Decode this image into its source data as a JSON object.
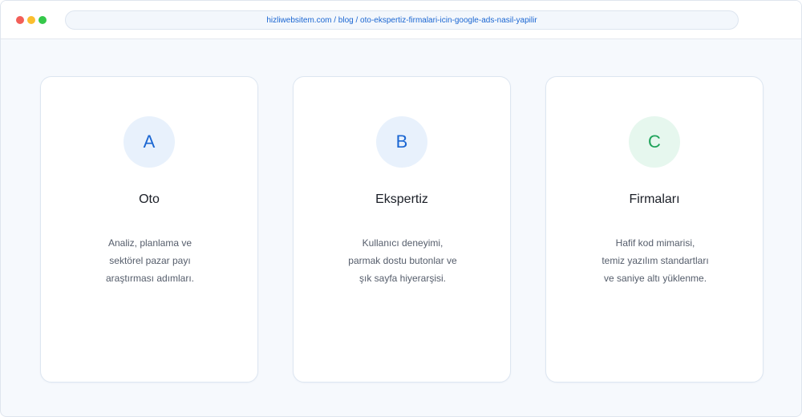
{
  "window": {
    "controls": [
      "close",
      "minimize",
      "maximize"
    ],
    "url": "hizliwebsitem.com / blog / oto-ekspertiz-firmalari-icin-google-ads-nasil-yapilir"
  },
  "colors": {
    "accent_blue": "#1a66d2",
    "accent_green": "#1ea35a"
  },
  "cards": [
    {
      "badge": "A",
      "title": "Oto",
      "desc": [
        "Analiz, planlama ve",
        "sektörel pazar payı",
        "araştırması adımları."
      ]
    },
    {
      "badge": "B",
      "title": "Ekspertiz",
      "desc": [
        "Kullanıcı deneyimi,",
        "parmak dostu butonlar ve",
        "şık sayfa hiyerarşisi."
      ]
    },
    {
      "badge": "C",
      "title": "Firmaları",
      "desc": [
        "Hafif kod mimarisi,",
        "temiz yazılım standartları",
        "ve saniye altı yüklenme."
      ]
    }
  ]
}
